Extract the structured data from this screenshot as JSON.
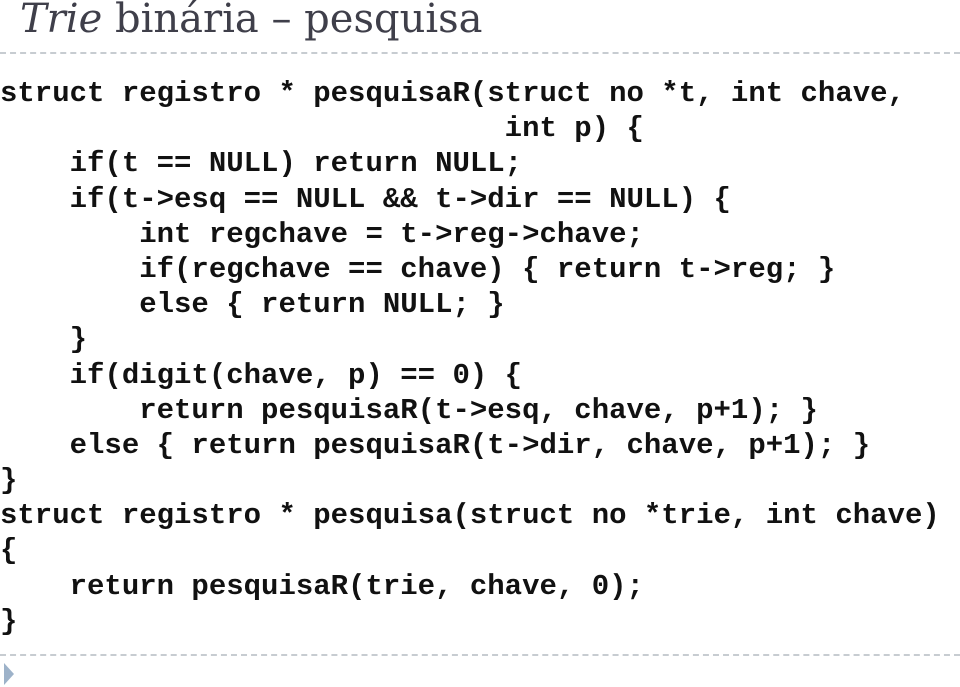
{
  "title": {
    "italic_part": "Trie",
    "rest": " binária – pesquisa"
  },
  "code_lines": [
    "struct registro * pesquisaR(struct no *t, int chave,",
    "                             int p) {",
    "    if(t == NULL) return NULL;",
    "    if(t->esq == NULL && t->dir == NULL) {",
    "        int regchave = t->reg->chave;",
    "        if(regchave == chave) { return t->reg; }",
    "        else { return NULL; }",
    "    }",
    "    if(digit(chave, p) == 0) {",
    "        return pesquisaR(t->esq, chave, p+1); }",
    "    else { return pesquisaR(t->dir, chave, p+1); }",
    "}",
    "struct registro * pesquisa(struct no *trie, int chave)",
    "{",
    "    return pesquisaR(trie, chave, 0);",
    "}"
  ],
  "bullet_icon": "triangle-bullet",
  "colors": {
    "title": "#3f3f4a",
    "code": "#111111",
    "rule": "#c7ccd1",
    "bullet": "#9db2c9"
  }
}
